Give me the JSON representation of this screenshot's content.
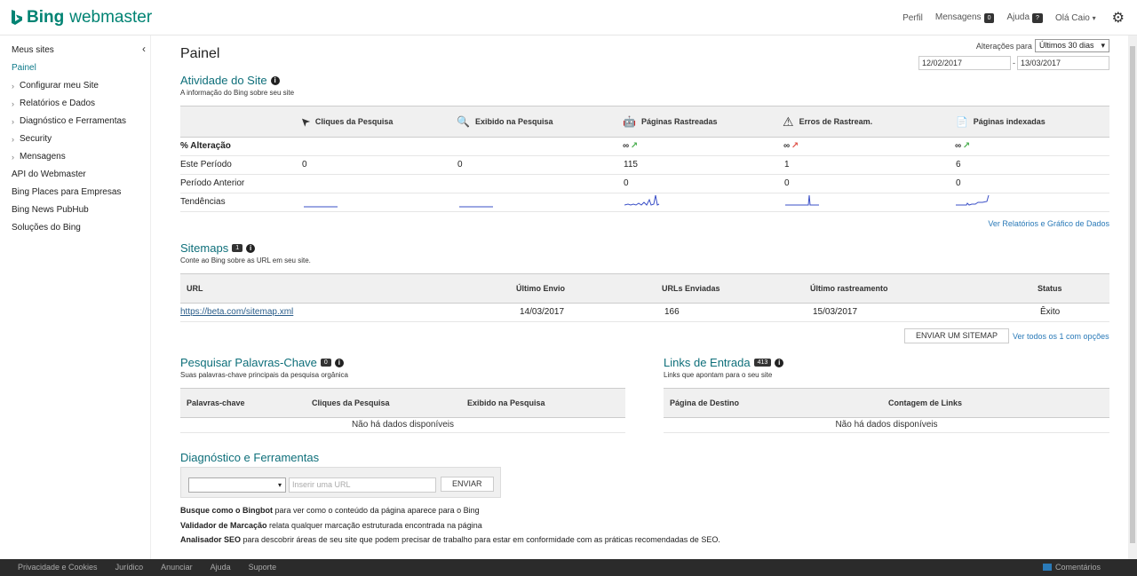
{
  "header": {
    "logo_bing": "Bing",
    "logo_webmaster": "webmaster",
    "perfil": "Perfil",
    "mensagens": "Mensagens",
    "mensagens_count": "0",
    "ajuda": "Ajuda",
    "ajuda_badge": "?",
    "user": "Olá Caio",
    "user_chevron": "▾",
    "gear_icon": "⚙"
  },
  "sidebar": {
    "collapse_icon": "‹",
    "items": [
      {
        "label": "Meus sites",
        "chevron": ""
      },
      {
        "label": "Painel",
        "chevron": ""
      },
      {
        "label": "Configurar meu Site",
        "chevron": "›"
      },
      {
        "label": "Relatórios e Dados",
        "chevron": "›"
      },
      {
        "label": "Diagnóstico e Ferramentas",
        "chevron": "›"
      },
      {
        "label": "Security",
        "chevron": "›"
      },
      {
        "label": "Mensagens",
        "chevron": "›"
      },
      {
        "label": "API do Webmaster",
        "chevron": ""
      },
      {
        "label": "Bing Places para Empresas",
        "chevron": ""
      },
      {
        "label": "Bing News PubHub",
        "chevron": ""
      },
      {
        "label": "Soluções do Bing",
        "chevron": ""
      }
    ]
  },
  "main": {
    "title": "Painel",
    "range_label": "Alterações para",
    "range_value": "Últimos 30 dias",
    "range_chevron": "▾",
    "date_from": "12/02/2017",
    "date_sep": "-",
    "date_to": "13/03/2017"
  },
  "activity": {
    "title": "Atividade do Site",
    "info": "i",
    "subtitle": "A informação do Bing sobre seu site",
    "columns": [
      {
        "icon": "cursor-icon",
        "glyph": "➤",
        "label": "Cliques da Pesquisa"
      },
      {
        "icon": "search-icon",
        "glyph": "🔍",
        "label": "Exibido na Pesquisa"
      },
      {
        "icon": "robot-icon",
        "glyph": "🤖",
        "label": "Páginas Rastreadas"
      },
      {
        "icon": "warning-icon",
        "glyph": "⚠",
        "label": "Erros de Rastream."
      },
      {
        "icon": "document-icon",
        "glyph": "📄",
        "label": "Páginas indexadas"
      }
    ],
    "row_labels": {
      "change": "% Alteração",
      "current": "Este Período",
      "previous": "Período Anterior",
      "trends": "Tendências"
    },
    "change": {
      "crawled": "∞",
      "errors": "∞",
      "indexed": "∞",
      "arrow": "↗"
    },
    "current": {
      "clicks": "0",
      "impressions": "0",
      "crawled": "115",
      "errors": "1",
      "indexed": "6"
    },
    "previous": {
      "crawled": "0",
      "errors": "0",
      "indexed": "0"
    },
    "sparkline_color": "#3a4fc7",
    "more_link": "Ver Relatórios e Gráfico de Dados"
  },
  "sitemaps": {
    "title": "Sitemaps",
    "count": "1",
    "info": "i",
    "subtitle": "Conte ao Bing sobre as URL em seu site.",
    "headers": {
      "url": "URL",
      "last_sent": "Último Envio",
      "urls_sent": "URLs Enviadas",
      "last_crawl": "Último rastreamento",
      "status": "Status"
    },
    "row": {
      "url": "https://beta.com/sitemap.xml",
      "last_sent": "14/03/2017",
      "urls_sent": "166",
      "last_crawl": "15/03/2017",
      "status": "Êxito"
    },
    "submit_button": "ENVIAR UM SITEMAP",
    "view_all": "Ver todos os 1 com opções"
  },
  "keywords": {
    "title": "Pesquisar Palavras-Chave",
    "count": "0",
    "info": "i",
    "subtitle": "Suas palavras-chave principais da pesquisa orgânica",
    "headers": {
      "keyword": "Palavras-chave",
      "clicks": "Cliques da Pesquisa",
      "impressions": "Exibido na Pesquisa"
    },
    "no_data": "Não há dados disponíveis"
  },
  "inbound": {
    "title": "Links de Entrada",
    "count": "413",
    "info": "i",
    "subtitle": "Links que apontam para o seu site",
    "headers": {
      "target": "Página de Destino",
      "count": "Contagem de Links"
    },
    "no_data": "Não há dados disponíveis"
  },
  "diagnostics": {
    "title": "Diagnóstico e Ferramentas",
    "select_chevron": "▾",
    "url_placeholder": "Inserir uma URL",
    "submit": "ENVIAR",
    "lines": [
      {
        "bold": "Busque como o Bingbot",
        "text": " para ver como o conteúdo da página aparece para o Bing"
      },
      {
        "bold": "Validador de Marcação",
        "text": " relata qualquer marcação estruturada encontrada na página"
      },
      {
        "bold": "Analisador SEO",
        "text": " para descobrir áreas de seu site que podem precisar de trabalho para estar em conformidade com as práticas recomendadas de SEO."
      }
    ]
  },
  "footer": {
    "links": [
      "Privacidade e Cookies",
      "Jurídico",
      "Anunciar",
      "Ajuda",
      "Suporte"
    ],
    "feedback": "Comentários"
  }
}
